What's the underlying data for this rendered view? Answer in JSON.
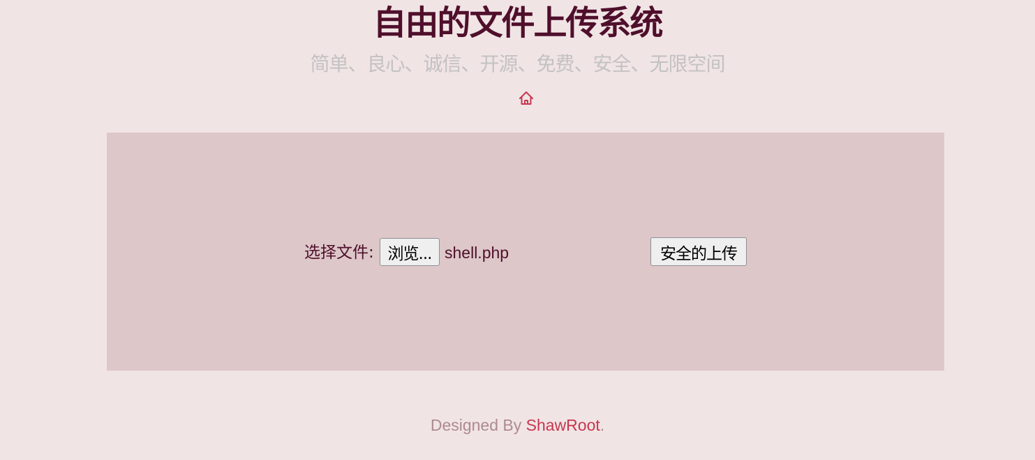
{
  "header": {
    "title": "自由的文件上传系统",
    "subtitle": "简单、良心、诚信、开源、免费、安全、无限空间",
    "home_icon": "home-icon"
  },
  "upload_form": {
    "file_label": "选择文件:",
    "browse_button": "浏览...",
    "selected_file": "shell.php",
    "upload_button": "安全的上传"
  },
  "footer": {
    "prefix": "Designed By ",
    "author": "ShawRoot",
    "suffix": "."
  },
  "colors": {
    "background": "#f1e4e5",
    "panel": "#ddc7c9",
    "title": "#4f0f2b",
    "subtitle": "#c3c2c3",
    "accent": "#c7374e",
    "footer_text": "#ad8a91"
  }
}
